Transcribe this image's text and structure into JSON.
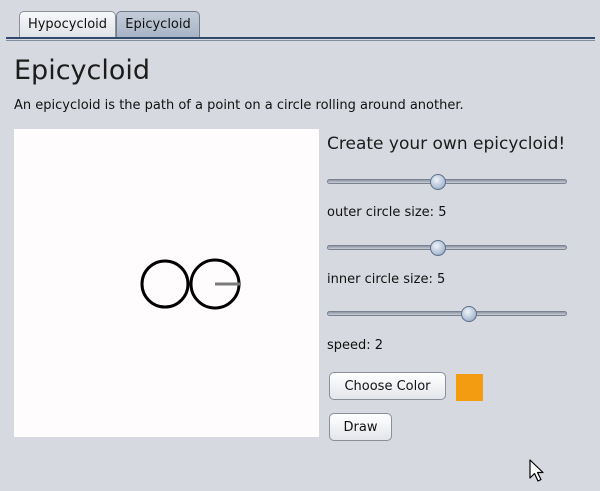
{
  "tabs": [
    {
      "label": "Hypocycloid",
      "selected": false
    },
    {
      "label": "Epicycloid",
      "selected": true
    }
  ],
  "page": {
    "title": "Epicycloid",
    "description": "An epicycloid is the path of a point on a circle rolling around another."
  },
  "panel": {
    "heading": "Create your own epicycloid!",
    "sliders": [
      {
        "label": "outer circle size: 5",
        "value_fraction": 0.46
      },
      {
        "label": "inner circle size: 5",
        "value_fraction": 0.46
      },
      {
        "label": "speed: 2",
        "value_fraction": 0.6
      }
    ],
    "choose_color_label": "Choose Color",
    "draw_label": "Draw",
    "selected_color": "#f39c12"
  },
  "colors": {
    "background": "#d6d9df",
    "canvas": "#fefcfd",
    "tab_selected": "#a7b4c6",
    "slider_thumb": "#a9bad2"
  },
  "icons": {
    "cursor": "arrow-cursor-icon"
  }
}
